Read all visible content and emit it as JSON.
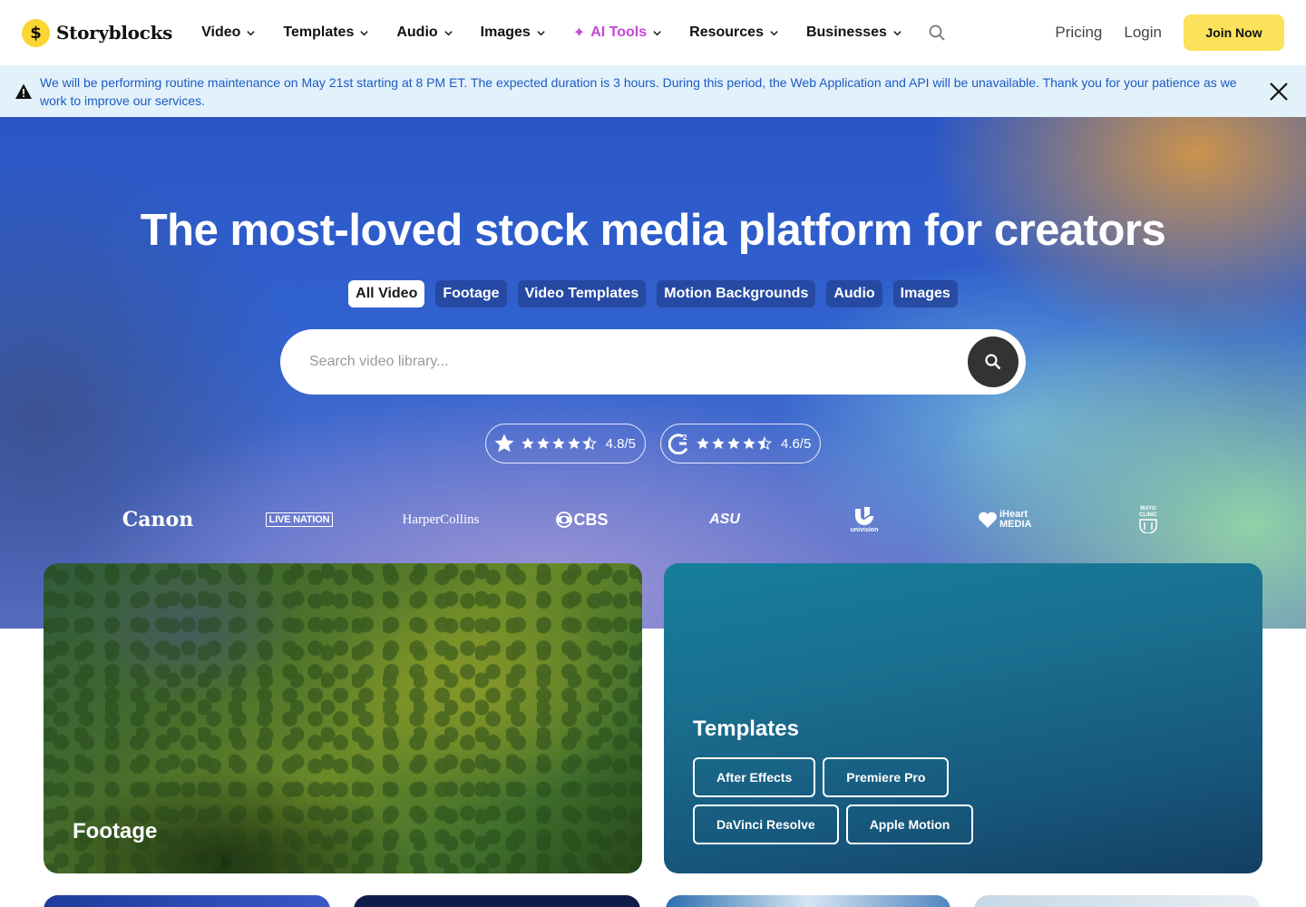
{
  "nav": {
    "logo_text": "Storyblocks",
    "logo_mark": "$",
    "items": [
      {
        "label": "Video"
      },
      {
        "label": "Templates"
      },
      {
        "label": "Audio"
      },
      {
        "label": "Images"
      },
      {
        "label": "AI Tools",
        "prefix": "✦"
      },
      {
        "label": "Resources"
      },
      {
        "label": "Businesses"
      }
    ],
    "pricing": "Pricing",
    "login": "Login",
    "join": "Join Now"
  },
  "banner": {
    "text": "We will be performing routine maintenance on May 21st starting at 8 PM ET. The expected duration is 3 hours. During this period, the Web Application and API will be unavailable. Thank you for your patience as we work to improve our services."
  },
  "hero": {
    "title": "The most-loved stock media platform for creators",
    "tabs": [
      "All Video",
      "Footage",
      "Video Templates",
      "Motion Backgrounds",
      "Audio",
      "Images"
    ],
    "active_tab": "All Video",
    "search_placeholder": "Search video library...",
    "ratings": [
      {
        "source_icon": "star-icon",
        "value": "4.8/5",
        "stars": 4.5
      },
      {
        "source_icon": "g2-icon",
        "value": "4.6/5",
        "stars": 4.5
      }
    ],
    "brands": [
      "Canon",
      "LIVE NATION",
      "HarperCollins",
      "CBS",
      "ASU",
      "univision",
      "iHeart MEDIA",
      "MAYO CLINIC"
    ]
  },
  "cards": {
    "footage": {
      "label": "Footage"
    },
    "templates": {
      "title": "Templates",
      "buttons": [
        "After Effects",
        "Premiere Pro",
        "DaVinci Resolve",
        "Apple Motion"
      ]
    }
  },
  "colors": {
    "accent_yellow": "#fbe25a",
    "logo_yellow": "#fbd634",
    "ai_pink": "#c447d6",
    "banner_bg": "#e3f1fb",
    "banner_text": "#1b5bc4"
  }
}
